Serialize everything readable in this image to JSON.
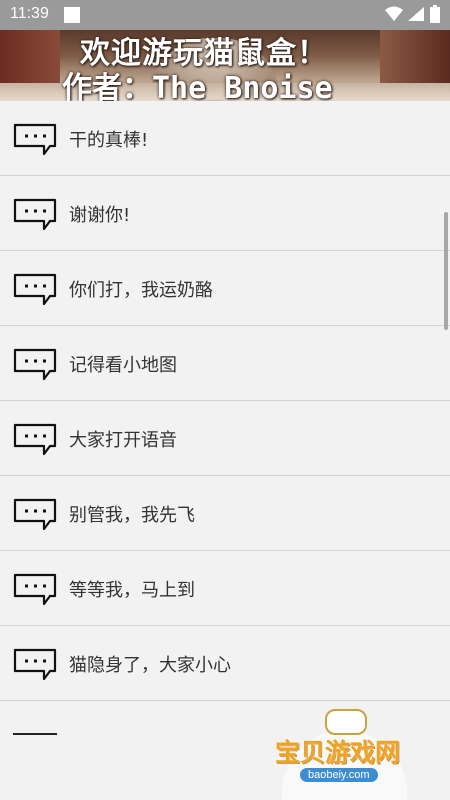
{
  "status_bar": {
    "time": "11:39"
  },
  "banner": {
    "line1": "欢迎游玩猫鼠盒！",
    "line2": "作者：The_Bnoise"
  },
  "messages": [
    {
      "text": "干的真棒!"
    },
    {
      "text": "谢谢你!"
    },
    {
      "text": "你们打，我运奶酪"
    },
    {
      "text": "记得看小地图"
    },
    {
      "text": "大家打开语音"
    },
    {
      "text": "别管我，我先飞"
    },
    {
      "text": "等等我，马上到"
    },
    {
      "text": "猫隐身了，大家小心"
    }
  ],
  "watermark": {
    "title": "宝贝游戏网",
    "url": "baobeiy.com"
  },
  "colors": {
    "status_bar": "#9a9a9a",
    "list_bg": "#f2f2f2",
    "divider": "#d4d4d4",
    "watermark": "#f0a321"
  }
}
